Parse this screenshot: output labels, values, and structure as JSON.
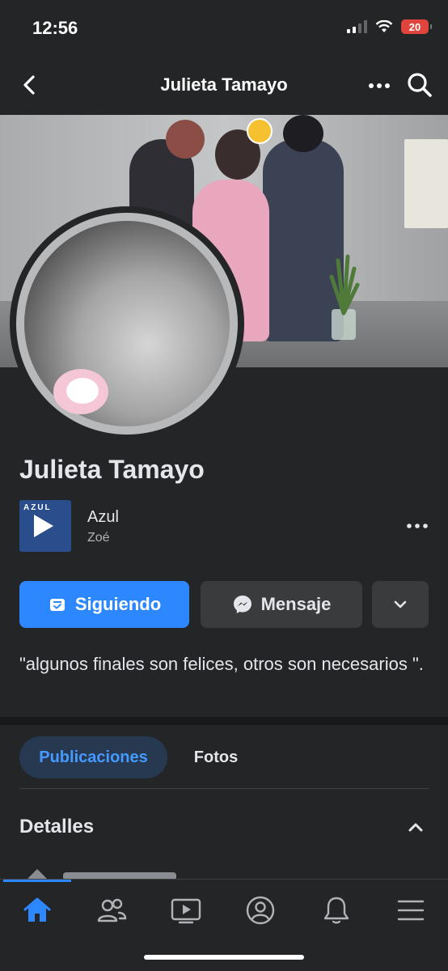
{
  "status_bar": {
    "time": "12:56",
    "battery": "20"
  },
  "nav": {
    "title": "Julieta Tamayo",
    "back_icon": "chevron-left-icon",
    "more_icon": "more-icon",
    "search_icon": "search-icon"
  },
  "profile": {
    "name": "Julieta Tamayo"
  },
  "song": {
    "cover_text": "AZUL",
    "title": "Azul",
    "artist": "Zoé"
  },
  "actions": {
    "following_label": "Siguiendo",
    "message_label": "Mensaje"
  },
  "bio": {
    "text": "\"algunos finales son felices, otros son necesarios \"."
  },
  "tabs": [
    {
      "label": "Publicaciones",
      "active": true
    },
    {
      "label": "Fotos",
      "active": false
    }
  ],
  "details": {
    "title": "Detalles"
  },
  "tabbar": {
    "items": [
      {
        "icon": "home-icon",
        "active": true
      },
      {
        "icon": "friends-icon",
        "active": false
      },
      {
        "icon": "watch-icon",
        "active": false
      },
      {
        "icon": "profile-icon",
        "active": false
      },
      {
        "icon": "bell-icon",
        "active": false
      },
      {
        "icon": "menu-icon",
        "active": false
      }
    ]
  },
  "colors": {
    "accent": "#2d88ff",
    "background": "#242526",
    "button_secondary": "#3a3b3c"
  }
}
